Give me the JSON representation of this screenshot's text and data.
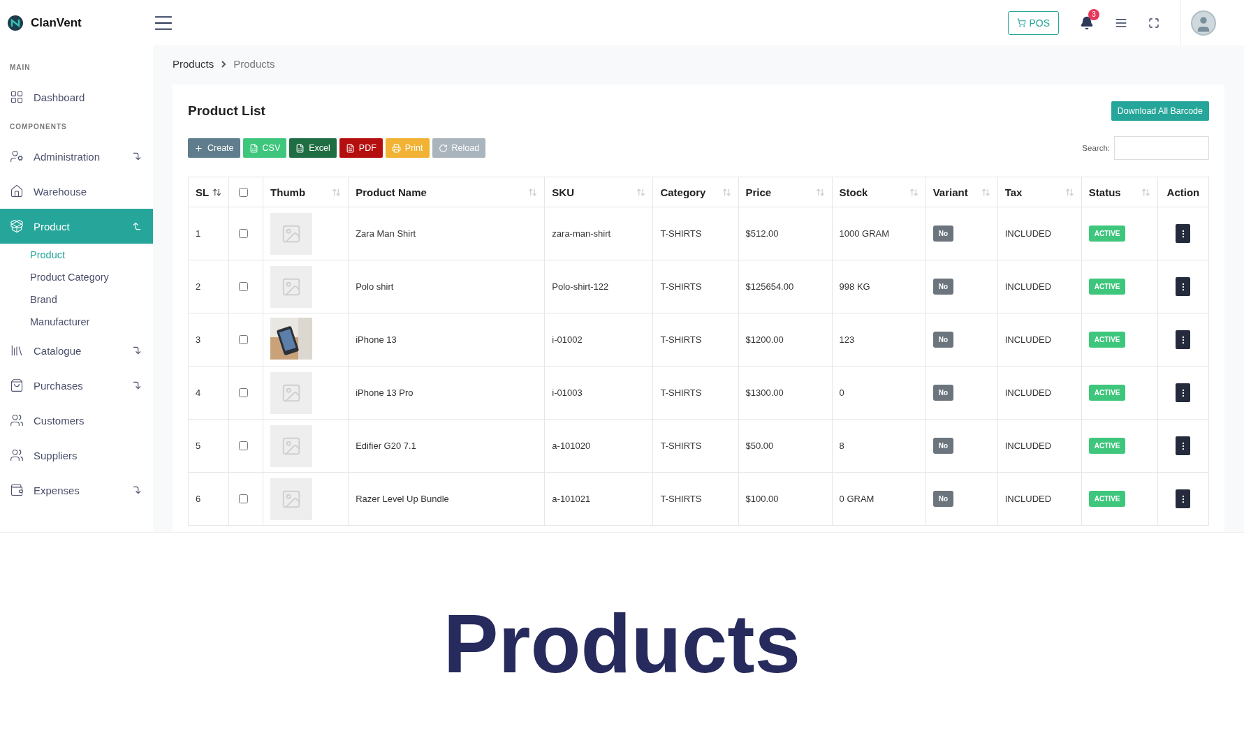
{
  "brand": {
    "name": "ClanVent"
  },
  "topbar": {
    "pos_button": "POS",
    "notification_count": "3"
  },
  "sidebar": [
    {
      "kind": "section",
      "label": "MAIN"
    },
    {
      "kind": "item",
      "label": "Dashboard",
      "selected": false
    },
    {
      "kind": "section",
      "label": "COMPONENTS"
    },
    {
      "kind": "item",
      "label": "Administration",
      "selected": false,
      "expanded": false
    },
    {
      "kind": "item",
      "label": "Warehouse",
      "selected": false
    },
    {
      "kind": "item",
      "label": "Product",
      "selected": true,
      "expanded": true,
      "children": [
        {
          "label": "Product",
          "selected": true
        },
        {
          "label": "Product Category",
          "selected": false
        },
        {
          "label": "Brand",
          "selected": false
        },
        {
          "label": "Manufacturer",
          "selected": false
        }
      ]
    },
    {
      "kind": "item",
      "label": "Catalogue",
      "selected": false,
      "expanded": false
    },
    {
      "kind": "item",
      "label": "Purchases",
      "selected": false,
      "expanded": false
    },
    {
      "kind": "item",
      "label": "Customers",
      "selected": false
    },
    {
      "kind": "item",
      "label": "Suppliers",
      "selected": false
    },
    {
      "kind": "item",
      "label": "Expenses",
      "selected": false,
      "expanded": false
    }
  ],
  "breadcrumb": [
    "Products",
    "Products"
  ],
  "card": {
    "title": "Product List",
    "download_button": "Download All Barcode",
    "actions": [
      {
        "kind": "create",
        "label": "Create"
      },
      {
        "kind": "csv",
        "label": "CSV"
      },
      {
        "kind": "excel",
        "label": "Excel"
      },
      {
        "kind": "pdf",
        "label": "PDF"
      },
      {
        "kind": "print",
        "label": "Print"
      },
      {
        "kind": "reload",
        "label": "Reload"
      }
    ],
    "search_label": "Search:"
  },
  "table": {
    "columns": [
      {
        "kind": "text",
        "label": "SL",
        "sorted": true
      },
      {
        "kind": "checkbox",
        "checked": false
      },
      {
        "kind": "text",
        "label": "Thumb",
        "sorted": false
      },
      {
        "kind": "text",
        "label": "Product Name",
        "sorted": false
      },
      {
        "kind": "text",
        "label": "SKU",
        "sorted": false
      },
      {
        "kind": "text",
        "label": "Category",
        "sorted": false
      },
      {
        "kind": "text",
        "label": "Price",
        "sorted": false
      },
      {
        "kind": "text",
        "label": "Stock",
        "sorted": false
      },
      {
        "kind": "text",
        "label": "Variant",
        "sorted": false
      },
      {
        "kind": "text",
        "label": "Tax",
        "sorted": false
      },
      {
        "kind": "text",
        "label": "Status",
        "sorted": false
      },
      {
        "kind": "plain",
        "label": "Action"
      }
    ],
    "rows": [
      {
        "sl": "1",
        "checked": false,
        "thumb": {
          "kind": "placeholder"
        },
        "name": "Zara Man Shirt",
        "sku": "zara-man-shirt",
        "category": "T-SHIRTS",
        "price": "$512.00",
        "stock": "1000 GRAM",
        "variant": "No",
        "tax": "INCLUDED",
        "status": "ACTIVE"
      },
      {
        "sl": "2",
        "checked": false,
        "thumb": {
          "kind": "placeholder"
        },
        "name": "Polo shirt",
        "sku": "Polo-shirt-122",
        "category": "T-SHIRTS",
        "price": "$125654.00",
        "stock": "998 KG",
        "variant": "No",
        "tax": "INCLUDED",
        "status": "ACTIVE"
      },
      {
        "sl": "3",
        "checked": false,
        "name": "iPhone 13",
        "sku": "i-01002",
        "category": "T-SHIRTS",
        "price": "$1200.00",
        "stock": "123",
        "variant": "No",
        "tax": "INCLUDED",
        "status": "ACTIVE"
      },
      {
        "sl": "4",
        "checked": false,
        "thumb": {
          "kind": "placeholder"
        },
        "name": "iPhone 13 Pro",
        "sku": "i-01003",
        "category": "T-SHIRTS",
        "price": "$1300.00",
        "stock": "0",
        "variant": "No",
        "tax": "INCLUDED",
        "status": "ACTIVE"
      },
      {
        "sl": "5",
        "checked": false,
        "thumb": {
          "kind": "placeholder"
        },
        "name": "Edifier G20 7.1",
        "sku": "a-101020",
        "category": "T-SHIRTS",
        "price": "$50.00",
        "stock": "8",
        "variant": "No",
        "tax": "INCLUDED",
        "status": "ACTIVE"
      },
      {
        "sl": "6",
        "checked": false,
        "thumb": {
          "kind": "placeholder"
        },
        "name": "Razer Level Up Bundle",
        "sku": "a-101021",
        "category": "T-SHIRTS",
        "price": "$100.00",
        "stock": "0 GRAM",
        "variant": "No",
        "tax": "INCLUDED",
        "status": "ACTIVE"
      }
    ]
  },
  "caption": "Products"
}
